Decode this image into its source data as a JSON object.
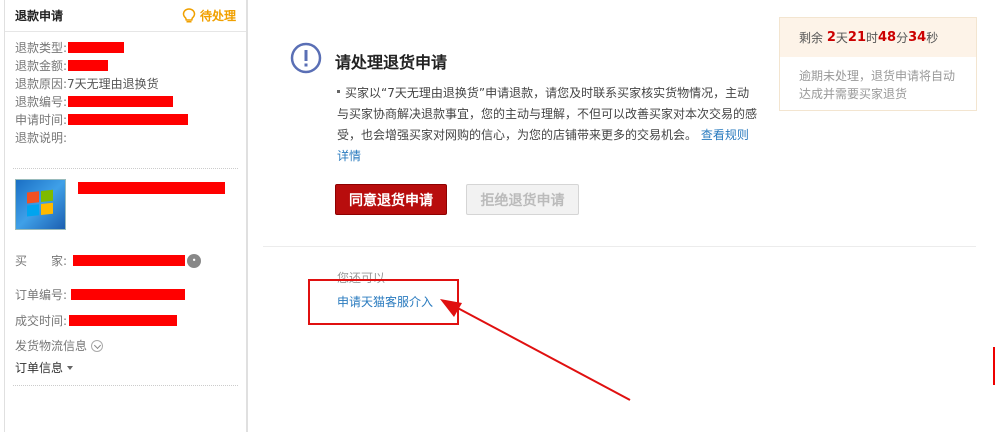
{
  "left_panel": {
    "title": "退款申请",
    "status": "待处理",
    "fields": [
      {
        "label": "退款类型:",
        "value": ""
      },
      {
        "label": "退款金额:",
        "value": ""
      },
      {
        "label": "退款原因:",
        "value": "7天无理由退换货"
      },
      {
        "label": "退款编号:",
        "value": ""
      },
      {
        "label": "申请时间:",
        "value": ""
      },
      {
        "label": "退款说明:",
        "value": ""
      }
    ],
    "buyer_label": "买　　家:",
    "order_no_label": "订单编号:",
    "deal_time_label": "成交时间:",
    "shipping_label": "发货物流信息",
    "order_info_label": "订单信息"
  },
  "main": {
    "title": "请处理退货申请",
    "description": "买家以“7天无理由退换货”申请退款，请您及时联系买家核实货物情况，主动与买家协商解决退款事宜，您的主动与理解，不但可以改善买家对本次交易的感受，也会增强买家对网购的信心，为您的店铺带来更多的交易机会。",
    "rules_link": "查看规则详情",
    "agree_button": "同意退货申请",
    "reject_button": "拒绝退货申请",
    "also_label": "您还可以",
    "tmall_link": "申请天猫客服介入"
  },
  "countdown": {
    "prefix": "剩余",
    "days": "2",
    "days_unit": "天",
    "hours": "21",
    "hours_unit": "时",
    "minutes": "48",
    "minutes_unit": "分",
    "seconds": "34",
    "seconds_unit": "秒",
    "note": "逾期未处理，退货申请将自动达成并需要买家退货"
  },
  "colors": {
    "accent_red": "#b80d0d",
    "link_blue": "#2a7bbf",
    "pending_orange": "#f0a000",
    "annotation_red": "#e01010"
  }
}
